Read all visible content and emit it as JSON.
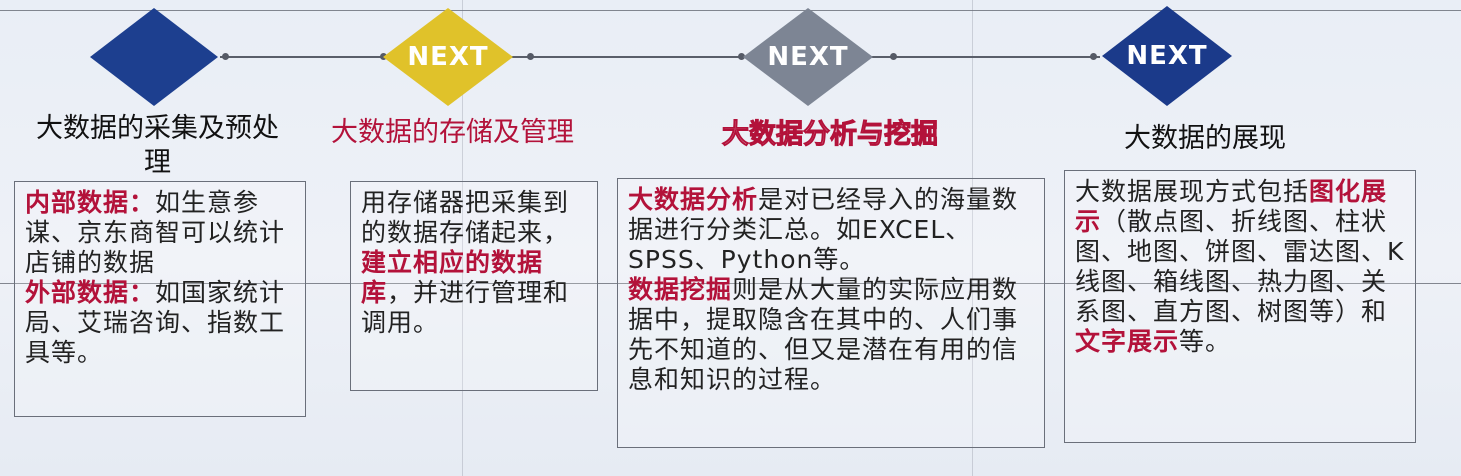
{
  "nodes": [
    {
      "label": "",
      "color": "#1d3f8f"
    },
    {
      "label": "NEXT",
      "color": "#e0c22a"
    },
    {
      "label": "NEXT",
      "color": "#7d8594"
    },
    {
      "label": "NEXT",
      "color": "#1b3a8a"
    }
  ],
  "steps": [
    {
      "title": "大数据的采集及预处理",
      "title_color": "#111111",
      "body": {
        "p1_key": "内部数据：",
        "p1_text": "如生意参谋、京东商智可以统计店铺的数据",
        "p2_key": "外部数据：",
        "p2_text": "如国家统计局、艾瑞咨询、指数工具等。"
      }
    },
    {
      "title": "大数据的存储及管理",
      "title_color": "#b3123a",
      "body": {
        "text1": "用存储器把采集到的数据存储起来，",
        "highlight": "建立相应的数据库",
        "text2": "，并进行管理和调用。"
      }
    },
    {
      "title": "大数据分析与挖掘",
      "title_color": "#e6a9bf",
      "body": {
        "key1": "大数据分析",
        "text1": "是对已经导入的海量数据进行分类汇总。如EXCEL、SPSS、Python等。",
        "key2": "数据挖掘",
        "text2": "则是从大量的实际应用数据中，提取隐含在其中的、人们事先不知道的、但又是潜在有用的信息和知识的过程。"
      }
    },
    {
      "title": "大数据的展现",
      "title_color": "#111111",
      "body": {
        "text1": "大数据展现方式包括",
        "key1": "图化展示",
        "text2": "（散点图、折线图、柱状图、地图、饼图、雷达图、K线图、箱线图、热力图、关系图、直方图、树图等）和",
        "key2": "文字展示",
        "text3": "等。"
      }
    }
  ]
}
